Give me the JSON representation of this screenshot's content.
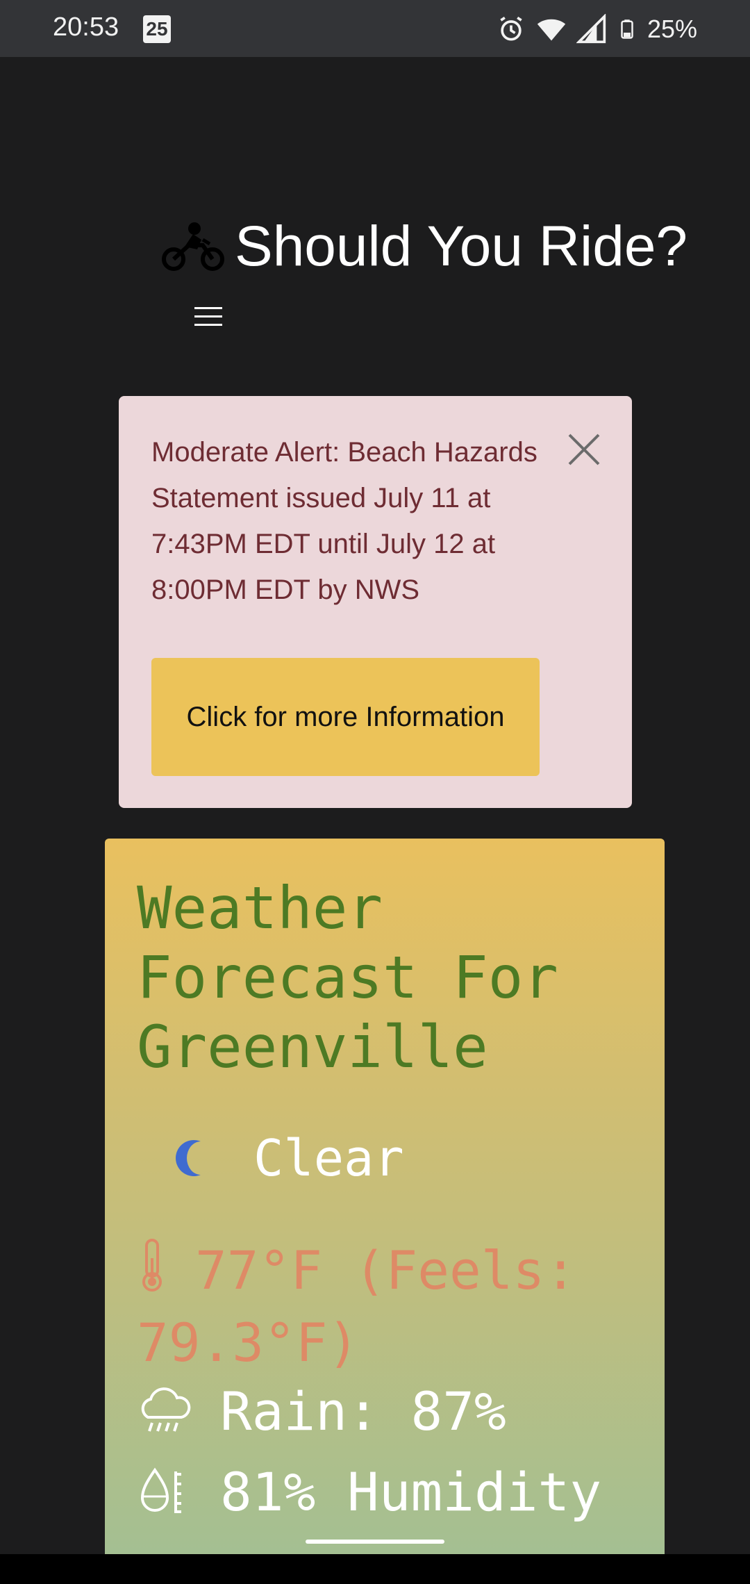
{
  "status_bar": {
    "time": "20:53",
    "notification_badge": "25",
    "battery_percent": "25%",
    "icons": [
      "alarm-icon",
      "wifi-icon",
      "signal-icon",
      "battery-icon"
    ]
  },
  "header": {
    "title": "Should You Ride?",
    "logo_icon": "motorcycle-icon",
    "menu_icon": "hamburger-menu-icon"
  },
  "alert": {
    "message": "Moderate Alert: Beach Hazards Statement issued July 11 at 7:43PM EDT until July 12 at 8:00PM EDT by NWS",
    "button_label": "Click for more Information",
    "background_color": "#ecd7da",
    "text_color": "#6e2c33",
    "button_color": "#ecc359"
  },
  "weather": {
    "title": "Weather Forecast For Greenville",
    "condition": "Clear",
    "condition_icon": "moon-icon",
    "temperature": "77°F (Feels: 79.3°F)",
    "temperature_icon": "thermometer-icon",
    "rain": "Rain: 87%",
    "rain_icon": "rain-cloud-icon",
    "humidity": "81% Humidity",
    "humidity_icon": "humidity-icon",
    "title_color": "#4d7a24",
    "temperature_color": "#de8a66"
  }
}
